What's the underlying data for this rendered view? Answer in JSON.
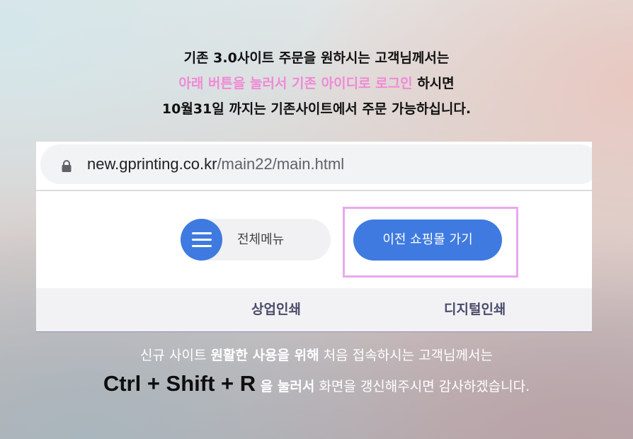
{
  "notice_top": {
    "line1": "기존 3.0사이트 주문을 원하시는 고객님께서는",
    "line2_pink": "아래 버튼을 눌러서 기존 아이디로 로그인",
    "line2_rest": " 하시면",
    "line3": "10월31일 까지는 기존사이트에서 주문 가능하십니다."
  },
  "browser": {
    "url_domain": "new.gprinting.co.kr",
    "url_path": "/main22/main.html",
    "menu_label": "전체메뉴",
    "prev_shop_label": "이전 쇼핑몰 가기",
    "nav_items": [
      "상업인쇄",
      "디지털인쇄"
    ]
  },
  "notice_bottom": {
    "line1_a": "신규 사이트 ",
    "line1_b": "원활한 사용을 위해",
    "line1_c": " 처음 접속하시는 고객님께서는",
    "shortcut": "Ctrl + Shift + R",
    "line2_bold": " 을 눌러서",
    "line2_rest": " 화면을 갱신해주시면 감사하겠습니다."
  },
  "colors": {
    "pink": "#f08ad6",
    "accent_blue": "#3f7ae0",
    "highlight_border": "#e7a9ee"
  },
  "icons": {
    "lock": "lock-icon",
    "menu": "hamburger-menu-icon"
  }
}
